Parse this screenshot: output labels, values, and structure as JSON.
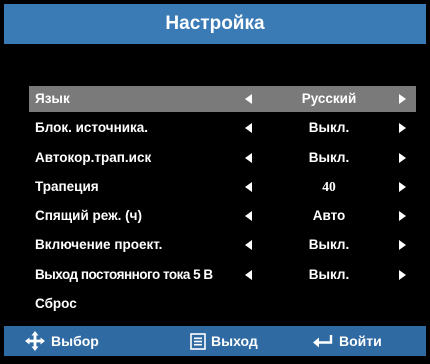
{
  "header": {
    "title": "Настройка"
  },
  "menu": {
    "items": [
      {
        "label": "Язык",
        "value": "Русский",
        "has_arrows": true,
        "selected": true
      },
      {
        "label": "Блок. источника.",
        "value": "Выкл.",
        "has_arrows": true
      },
      {
        "label": "Автокор.трап.иск",
        "value": "Выкл.",
        "has_arrows": true
      },
      {
        "label": "Трапеция",
        "value": "40",
        "has_arrows": true
      },
      {
        "label": "Спящий реж. (ч)",
        "value": "Авто",
        "has_arrows": true
      },
      {
        "label": "Включение проект.",
        "value": "Выкл.",
        "has_arrows": true
      },
      {
        "label": "Выход постоянного тока 5 В",
        "value": "Выкл.",
        "has_arrows": true
      },
      {
        "label": "Сброс",
        "value": "",
        "has_arrows": false
      }
    ]
  },
  "footer": {
    "select_label": "Выбор",
    "exit_label": "Выход",
    "enter_label": "Войти"
  },
  "colors": {
    "header_bg": "#3a7bb6",
    "selected_bg": "#7a7a7a",
    "footer_bg": "#2f6aa3"
  }
}
